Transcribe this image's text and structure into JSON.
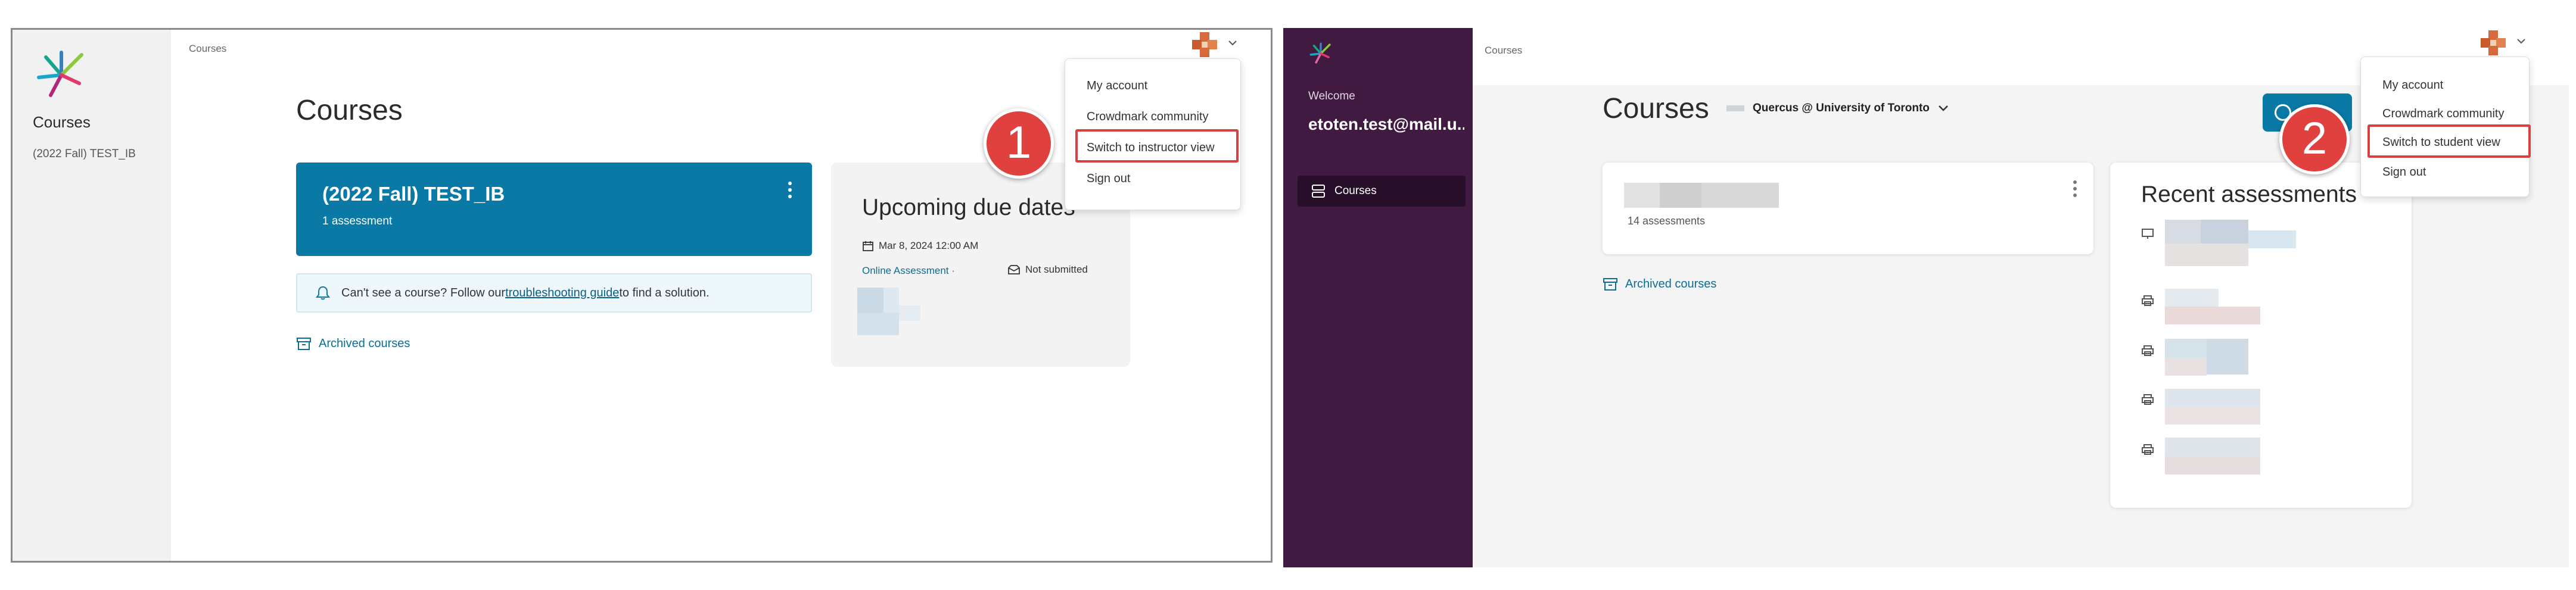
{
  "panel1": {
    "sidebar": {
      "title": "Courses",
      "course": "(2022 Fall) TEST_IB"
    },
    "breadcrumb": "Courses",
    "heading": "Courses",
    "course_card": {
      "title": "(2022 Fall) TEST_IB",
      "subtitle": "1 assessment"
    },
    "info": {
      "text_before": "Can't see a course? Follow our ",
      "link": "troubleshooting guide",
      "text_after": " to find a solution."
    },
    "archived": "Archived courses",
    "due": {
      "title": "Upcoming due dates",
      "date": "Mar 8, 2024 12:00 AM",
      "assessment": "Online Assessment ·",
      "status": "Not submitted"
    },
    "menu": [
      "My account",
      "Crowdmark community",
      "Switch to instructor view",
      "Sign out"
    ],
    "step": "1"
  },
  "panel2": {
    "breadcrumb": "Courses",
    "sidebar": {
      "welcome": "Welcome",
      "user": "etoten.test@mail.u...",
      "nav": "Courses"
    },
    "heading": "Courses",
    "org": "Quercus @ University of Toronto",
    "course_card": {
      "subtitle": "14 assessments"
    },
    "archived": "Archived courses",
    "recent_title": "Recent assessments",
    "menu": [
      "My account",
      "Crowdmark community",
      "Switch to student view",
      "Sign out"
    ],
    "step": "2"
  },
  "colors": {
    "accent": "#0a79a5",
    "sidebar_purple": "#401a41",
    "highlight": "#d64040"
  }
}
